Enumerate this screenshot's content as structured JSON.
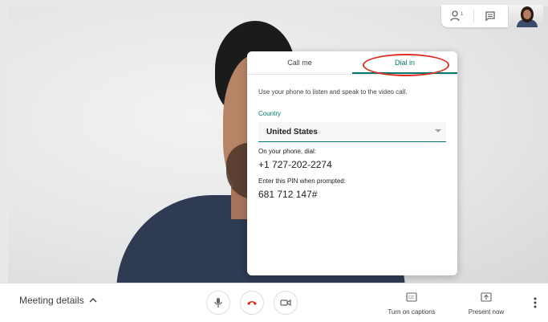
{
  "top_controls": {
    "participants_icon": "people-icon",
    "participant_count": "1",
    "chat_icon": "chat-icon"
  },
  "panel": {
    "tabs": [
      {
        "label": "Call me",
        "active": false
      },
      {
        "label": "Dial in",
        "active": true
      }
    ],
    "instructions": "Use your phone to listen and speak to the video call.",
    "country_label": "Country",
    "country_value": "United States",
    "dial_label": "On your phone, dial:",
    "dial_number": "+1 727-202-2274",
    "pin_label": "Enter this PIN when prompted:",
    "pin_value": "681 712 147#",
    "accent_color": "#00796b"
  },
  "bottom_bar": {
    "meeting_details": "Meeting details",
    "captions_label": "Turn on captions",
    "present_label": "Present now",
    "hangup_color": "#d93025"
  }
}
